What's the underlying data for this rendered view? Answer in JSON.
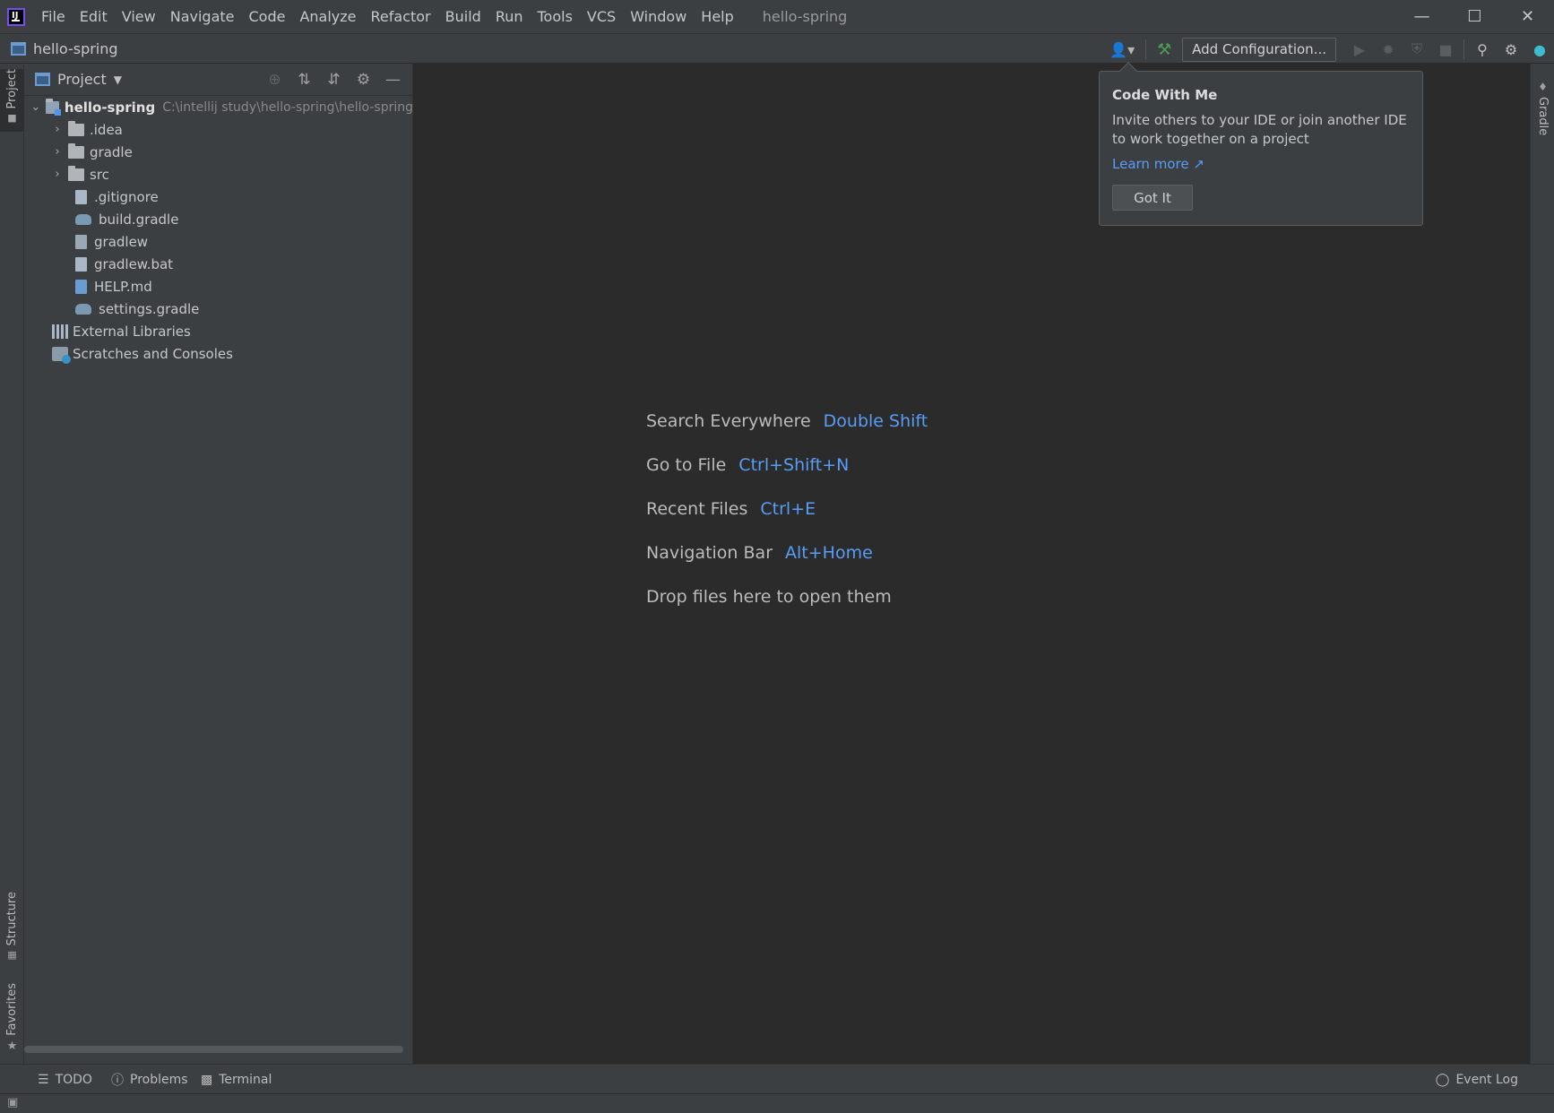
{
  "menubar": {
    "items": [
      "File",
      "Edit",
      "View",
      "Navigate",
      "Code",
      "Analyze",
      "Refactor",
      "Build",
      "Run",
      "Tools",
      "VCS",
      "Window",
      "Help"
    ],
    "window_title": "hello-spring"
  },
  "navbar": {
    "project_name": "hello-spring",
    "add_config_label": "Add Configuration..."
  },
  "left_stripe": {
    "project_tab": "Project",
    "structure_tab": "Structure",
    "favorites_tab": "Favorites"
  },
  "right_stripe": {
    "gradle_tab": "Gradle"
  },
  "project_panel": {
    "title": "Project",
    "tree": [
      {
        "label": "hello-spring",
        "path": "C:\\intellij study\\hello-spring\\hello-spring",
        "type": "project-root",
        "expanded": true
      },
      {
        "label": ".idea",
        "type": "folder",
        "expanded": false
      },
      {
        "label": "gradle",
        "type": "folder",
        "expanded": false
      },
      {
        "label": "src",
        "type": "folder",
        "expanded": false
      },
      {
        "label": ".gitignore",
        "type": "file"
      },
      {
        "label": "build.gradle",
        "type": "gradle-file"
      },
      {
        "label": "gradlew",
        "type": "exec-file"
      },
      {
        "label": "gradlew.bat",
        "type": "file"
      },
      {
        "label": "HELP.md",
        "type": "md-file"
      },
      {
        "label": "settings.gradle",
        "type": "gradle-file"
      },
      {
        "label": "External Libraries",
        "type": "libraries"
      },
      {
        "label": "Scratches and Consoles",
        "type": "scratches"
      }
    ]
  },
  "editor_hints": [
    {
      "label": "Search Everywhere",
      "shortcut": "Double Shift"
    },
    {
      "label": "Go to File",
      "shortcut": "Ctrl+Shift+N"
    },
    {
      "label": "Recent Files",
      "shortcut": "Ctrl+E"
    },
    {
      "label": "Navigation Bar",
      "shortcut": "Alt+Home"
    },
    {
      "label": "Drop files here to open them",
      "shortcut": ""
    }
  ],
  "popup": {
    "title": "Code With Me",
    "body": "Invite others to your IDE or join another IDE to work together on a project",
    "link": "Learn more ↗",
    "button": "Got It"
  },
  "bottombar": {
    "todo": "TODO",
    "problems": "Problems",
    "terminal": "Terminal",
    "event_log": "Event Log"
  },
  "colors": {
    "accent_link": "#589df6",
    "panel_bg": "#3c3f41",
    "editor_bg": "#2b2b2b",
    "build_icon": "#499c54"
  }
}
